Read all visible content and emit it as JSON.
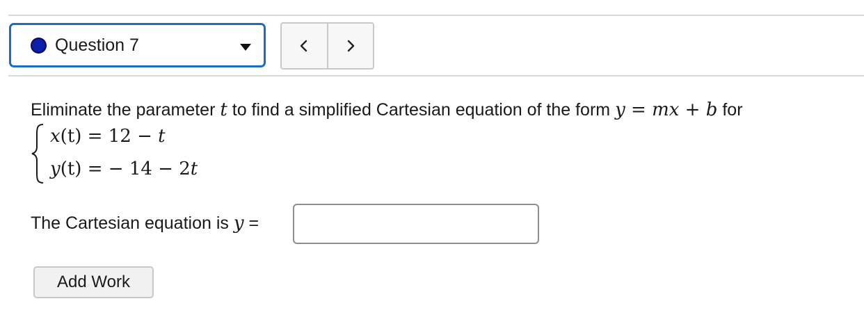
{
  "question_selector": {
    "label": "Question 7",
    "status_color": "#0b1fa8",
    "icons": [
      "status-dot-icon",
      "caret-down-icon"
    ]
  },
  "navigation": {
    "prev_symbol": "<",
    "next_symbol": ">",
    "icons": [
      "chevron-left-icon",
      "chevron-right-icon"
    ]
  },
  "problem": {
    "prompt_part1": "Eliminate the parameter ",
    "param": "t",
    "prompt_part2": " to find a simplified Cartesian equation of the form ",
    "form_y": "y",
    "form_eq": " = ",
    "form_m": "m",
    "form_x": "x",
    "form_plus": " + ",
    "form_b": "b",
    "prompt_part3": " for",
    "system": {
      "eq1_lhs": "x",
      "eq1_arg": "(t)",
      "eq1_rhs": " = 12 − ",
      "eq1_var": "t",
      "eq2_lhs": "y",
      "eq2_arg": "(t)",
      "eq2_rhs": " =  − 14 − 2",
      "eq2_var": "t"
    }
  },
  "answer": {
    "label": "The Cartesian equation is ",
    "var": "y",
    "equals": " =",
    "input_value": ""
  },
  "add_work_button": "Add Work"
}
